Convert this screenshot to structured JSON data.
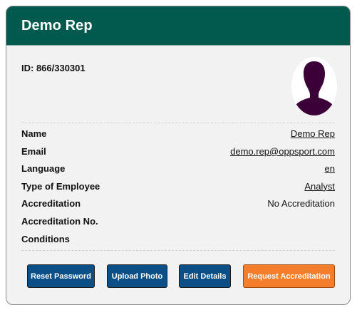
{
  "header": {
    "title": "Demo Rep"
  },
  "profile": {
    "id_text": "ID: 866/330301",
    "avatar_icon": "person-silhouette-icon",
    "avatar_color": "#3b0038"
  },
  "fields": [
    {
      "label": "Name",
      "value": "Demo Rep"
    },
    {
      "label": "Email",
      "value": "demo.rep@oppsport.com"
    },
    {
      "label": "Language",
      "value": "en"
    },
    {
      "label": "Type of Employee",
      "value": "Analyst"
    },
    {
      "label": "Accreditation",
      "value": "No Accreditation"
    },
    {
      "label": "Accreditation No.",
      "value": ""
    },
    {
      "label": "Conditions",
      "value": ""
    }
  ],
  "actions": {
    "reset_password": "Reset Password",
    "upload_photo": "Upload Photo",
    "edit_details": "Edit Details",
    "request_accreditation": "Request Accreditation"
  },
  "colors": {
    "header_bg": "#025a4e",
    "primary_button": "#0b4f86",
    "accent_button": "#f57e2c"
  }
}
